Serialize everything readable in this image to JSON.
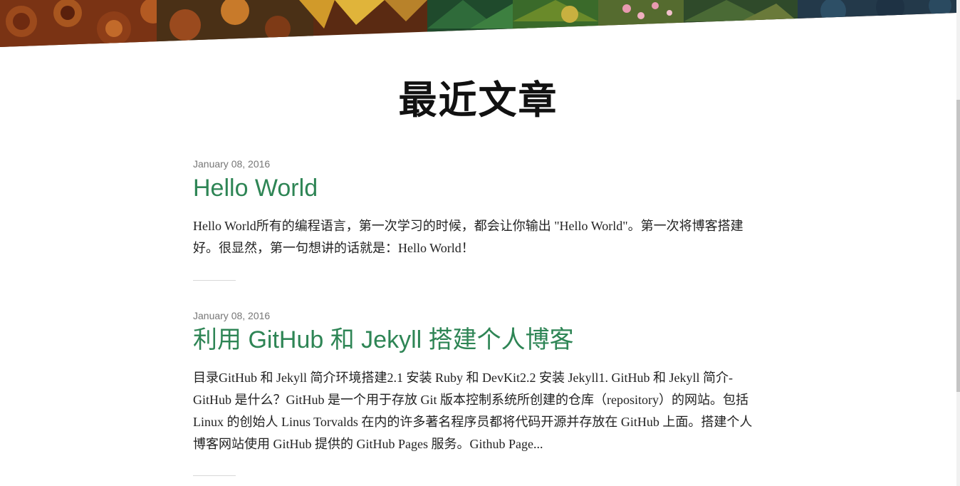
{
  "section": {
    "title": "最近文章"
  },
  "posts": [
    {
      "date": "January 08, 2016",
      "title": "Hello World",
      "excerpt": "Hello World所有的编程语言，第一次学习的时候，都会让你输出 \"Hello World\"。第一次将博客搭建好。很显然，第一句想讲的话就是：Hello World！"
    },
    {
      "date": "January 08, 2016",
      "title": "利用 GitHub 和 Jekyll 搭建个人博客",
      "excerpt": "目录GitHub 和 Jekyll 简介环境搭建2.1 安装 Ruby 和 DevKit2.2 安装 Jekyll1. GitHub 和 Jekyll 简介-GitHub 是什么？GitHub 是一个用于存放 Git 版本控制系统所创建的仓库（repository）的网站。包括 Linux 的创始人 Linus Torvalds 在内的许多著名程序员都将代码开源并存放在 GitHub 上面。搭建个人博客网站使用 GitHub 提供的 GitHub Pages 服务。Github Page..."
    }
  ],
  "colors": {
    "accent": "#2e8555",
    "date": "#777777",
    "text": "#222222"
  }
}
